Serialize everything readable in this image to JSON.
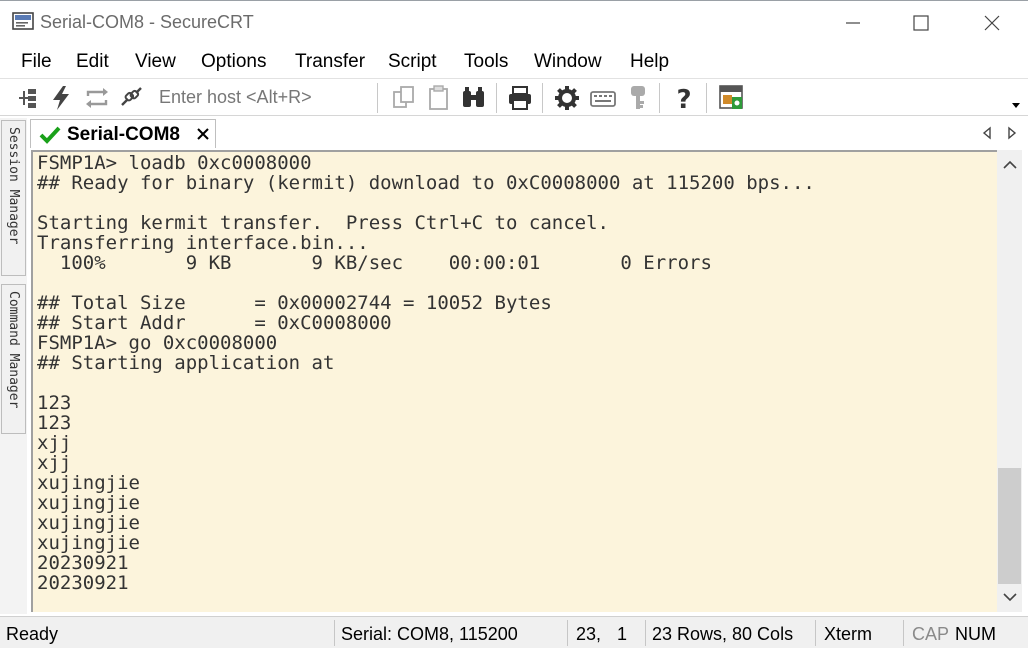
{
  "window": {
    "title": "Serial-COM8 - SecureCRT",
    "minimize_icon": "minimize-icon",
    "maximize_icon": "maximize-icon",
    "close_icon": "close-icon"
  },
  "menu": {
    "items": [
      "File",
      "Edit",
      "View",
      "Options",
      "Transfer",
      "Script",
      "Tools",
      "Window",
      "Help"
    ]
  },
  "toolbar": {
    "host_placeholder": "Enter host <Alt+R>",
    "icons": [
      "connect-bar-icon",
      "quick-connect-icon",
      "reconnect-icon",
      "disconnect-icon",
      "copy-icon",
      "paste-icon",
      "find-icon",
      "print-icon",
      "settings-icon",
      "keymap-icon",
      "key-agent-icon",
      "help-icon",
      "sftp-icon"
    ]
  },
  "side_panel": {
    "session_manager": "Session Manager",
    "command_manager": "Command Manager"
  },
  "tab": {
    "label": "Serial-COM8"
  },
  "terminal": {
    "lines": [
      "FSMP1A> loadb 0xc0008000",
      "## Ready for binary (kermit) download to 0xC0008000 at 115200 bps...",
      "",
      "Starting kermit transfer.  Press Ctrl+C to cancel.",
      "Transferring interface.bin...",
      "  100%       9 KB       9 KB/sec    00:00:01       0 Errors",
      "",
      "## Total Size      = 0x00002744 = 10052 Bytes",
      "## Start Addr      = 0xC0008000",
      "FSMP1A> go 0xc0008000",
      "## Starting application at",
      "",
      "123",
      "123",
      "xjj",
      "xjj",
      "xujingjie",
      "xujingjie",
      "xujingjie",
      "xujingjie",
      "20230921",
      "20230921"
    ],
    "background": "#fcf4dc",
    "foreground": "#333333"
  },
  "status": {
    "ready": "Ready",
    "connection": "Serial: COM8, 115200",
    "cursor_row": "23,",
    "cursor_col": "1",
    "size": "23 Rows, 80 Cols",
    "emulation": "Xterm",
    "caps": "CAP",
    "num": "NUM"
  },
  "colors": {
    "tab_check": "#1aa11a",
    "scroll_thumb": "#cdcdcd"
  }
}
